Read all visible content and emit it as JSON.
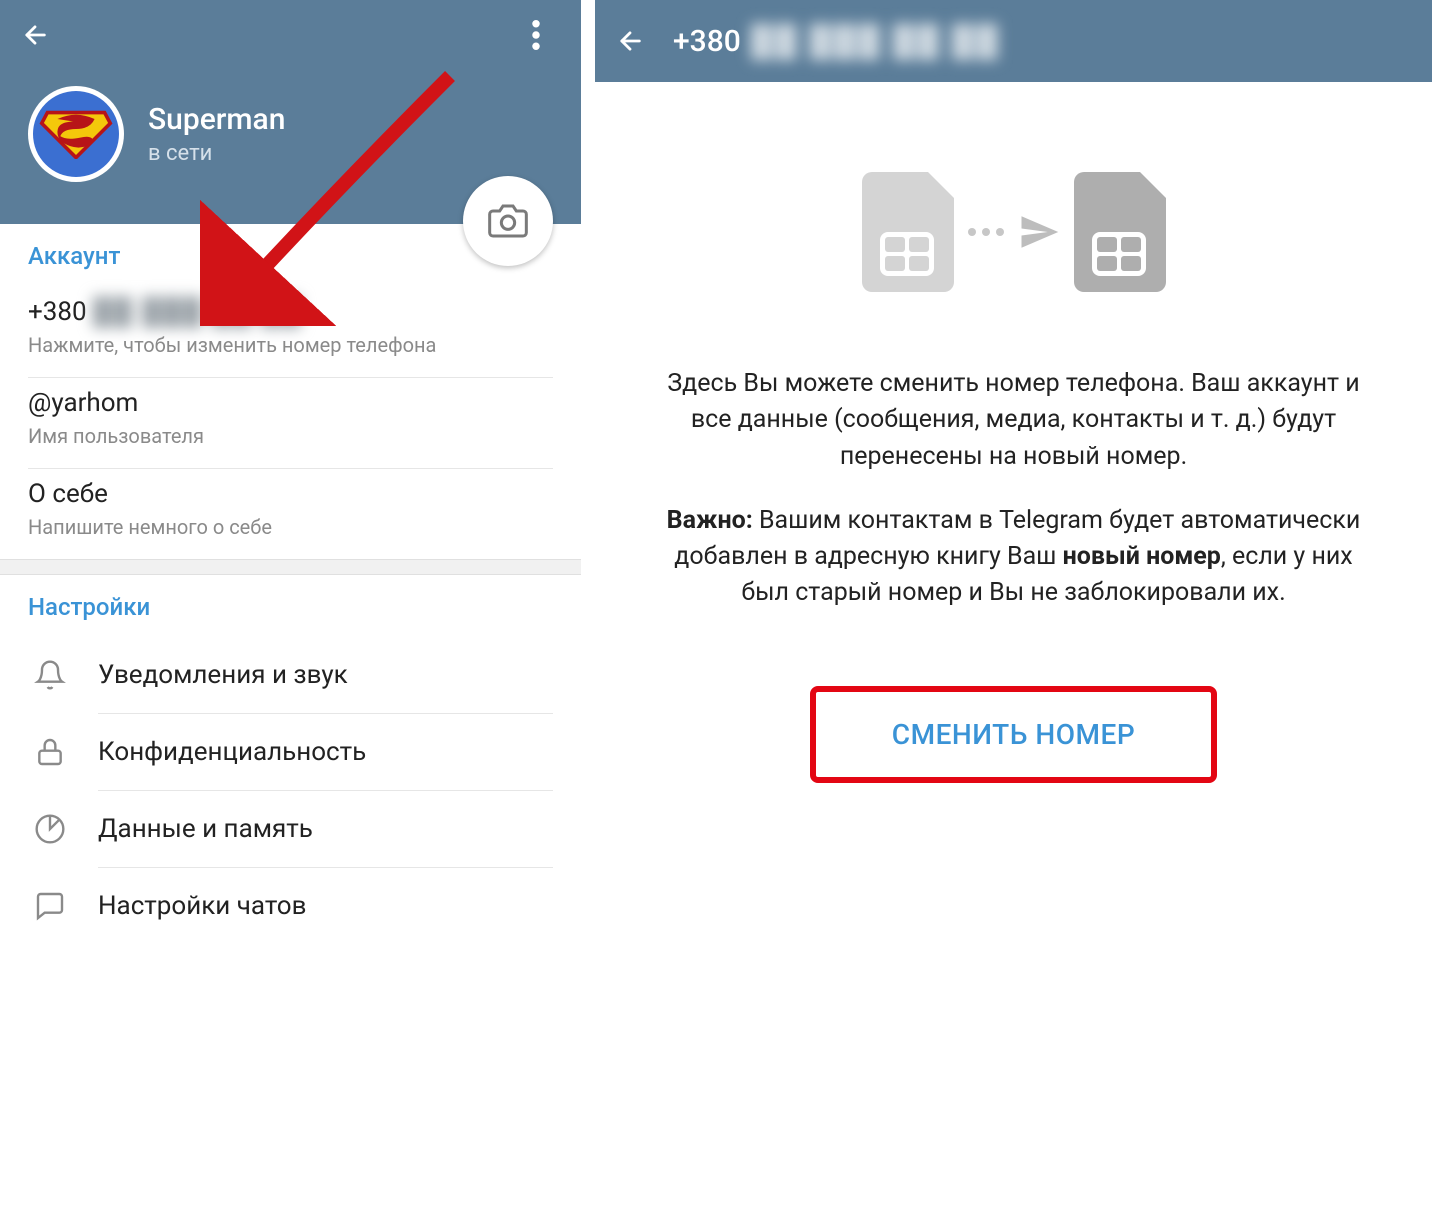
{
  "left": {
    "profile": {
      "name": "Superman",
      "status": "в сети"
    },
    "account": {
      "header": "Аккаунт",
      "phone_prefix": "+380",
      "phone_blurred": "██ ███ ██ ██",
      "phone_hint": "Нажмите, чтобы изменить номер телефона",
      "username": "@yarhom",
      "username_hint": "Имя пользователя",
      "bio_label": "О себе",
      "bio_hint": "Напишите немного о себе"
    },
    "settings": {
      "header": "Настройки",
      "items": [
        {
          "icon": "bell-icon",
          "label": "Уведомления и звук"
        },
        {
          "icon": "lock-icon",
          "label": "Конфиденциальность"
        },
        {
          "icon": "pie-icon",
          "label": "Данные и память"
        },
        {
          "icon": "chat-icon",
          "label": "Настройки чатов"
        }
      ]
    }
  },
  "right": {
    "title_prefix": "+380",
    "title_blurred": "██ ███ ██ ██",
    "paragraph1": "Здесь Вы можете сменить номер телефона. Ваш аккаунт и все данные (сообщения, медиа, контакты и т. д.) будут перенесены на новый номер.",
    "important_label": "Важно:",
    "paragraph2a": " Вашим контактам в Telegram будет автоматически добавлен в адресную книгу Ваш ",
    "bold_new_number": "новый номер",
    "paragraph2b": ", если у них был старый номер и Вы не заблокировали их.",
    "button": "СМЕНИТЬ НОМЕР"
  }
}
